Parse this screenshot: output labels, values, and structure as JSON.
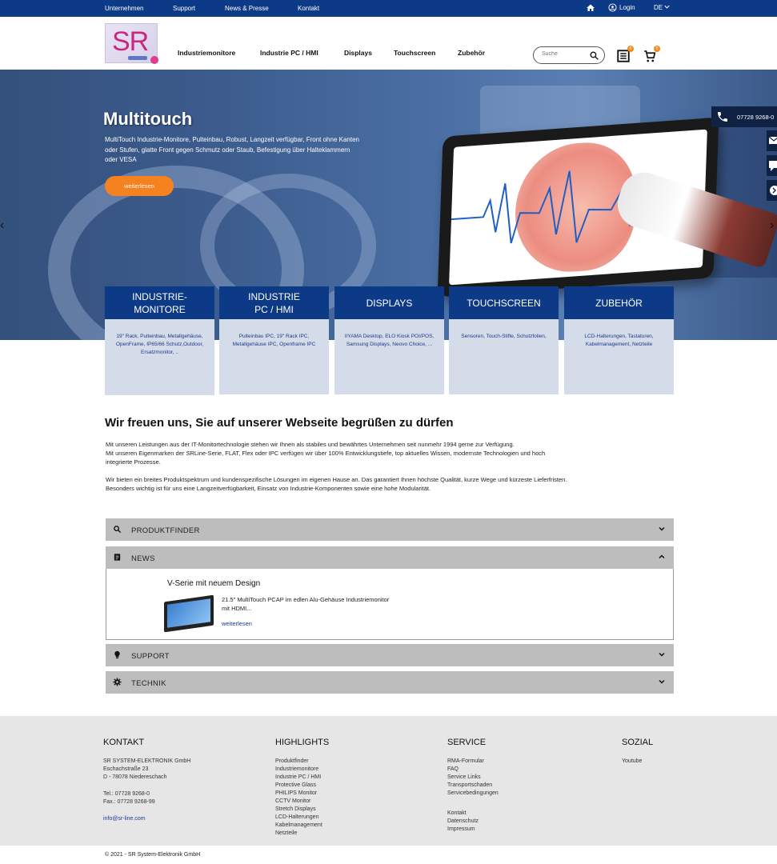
{
  "topbar": {
    "links": [
      "Unternehmen",
      "Support",
      "News & Presse",
      "Kontakt"
    ],
    "login": "Login",
    "lang": "DE"
  },
  "header": {
    "logo_text": "SR",
    "nav": [
      "Industriemonitore",
      "Industrie PC / HMI",
      "Displays",
      "Touchscreen",
      "Zubehör"
    ],
    "search_placeholder": "Suche",
    "list_badge": "0",
    "cart_badge": "0"
  },
  "hero": {
    "title": "Multitouch",
    "description": "MultiTouch Industrie-Monitore, Pulteinbau, Robust, Langzeit verfügbar, Front ohne Kanten oder Stufen, glatte Front gegen Schmutz oder Staub, Befestigung über Halteklammern oder VESA",
    "button": "weiterlesen",
    "phone": "07728 9268-0"
  },
  "categories": [
    {
      "title": "INDUSTRIE-\nMONITORE",
      "items": "19\" Rack, Pulteinbau, Metallgehäuse, OpenFrame, IP65/66 Schutz,Outdoor, Ersatzmonitor, .."
    },
    {
      "title": "INDUSTRIE\nPC / HMI",
      "items": "Pulteinbau IPC, 19\" Rack IPC, Metallgehäuse IPC, Openframe IPC"
    },
    {
      "title": "DISPLAYS",
      "items": "IIYAMA Desktop, ELO Kiosk POI/POS, Samsung Displays, Neovo Choice, ..."
    },
    {
      "title": "TOUCHSCREEN",
      "items": "Sensoren, Touch-Stifte, Schutzfolien,"
    },
    {
      "title": "ZUBEHÖR",
      "items": "LCD-Halterungen, Tastaturen, Kabelmanagement, Netzteile"
    }
  ],
  "welcome": {
    "heading": "Wir freuen uns, Sie auf unserer Webseite begrüßen zu dürfen",
    "p1_line1": "Mit unseren Leistungen aus der IT-Monitortechnologie stehen wir Ihnen als stabiles und bewährtes Unternehmen seit nunmehr 1994 gerne zur Verfügung.",
    "p1_line2": "Mit unseren Eigenmarken der SRLine-Serie, FLAT, Flex oder IPC verfügen wir über 100% Entwicklungstiefe, top aktuelles Wissen, modernste Technologien und hoch",
    "p1_line3": "integrierte Prozesse.",
    "p2_line1": "Wir bieten ein breites Produktspektrum und kundenspezifische Lösungen im eigenen Hause an. Das garantiert Ihnen höchste Qualität, kurze Wege und kürzeste Lieferfristen.",
    "p2_line2": "Besonders wichtig ist für uns eine Langzeitverfügbarkeit, Einsatz von Industrie-Komponenten sowie eine hohe Modularität."
  },
  "accordion": {
    "produktfinder": "PRODUKTFINDER",
    "news": "NEWS",
    "support": "SUPPORT",
    "technik": "TECHNIK"
  },
  "news_item": {
    "title": "V-Serie mit neuem Design",
    "text": "21.5\" MultiTouch PCAP im edlen Alu-Gehäuse Industriemonitor mit HDMI...",
    "more": "weiterlesen"
  },
  "footer": {
    "kontakt": {
      "heading": "KONTAKT",
      "company": "SR SYSTEM-ELEKTRONIK GmbH",
      "street": "Eschachstraße 23",
      "city": "D - 78078 Niedereschach",
      "tel": "Tel.: 07728 9268-0",
      "fax": "Fax.: 07728 9268-99",
      "email": "info@sr-line.com"
    },
    "highlights": {
      "heading": "HIGHLIGHTS",
      "items": [
        "Produktfinder",
        "Industriemonitore",
        "Industrie PC / HMI",
        "Protective Glass",
        "PHILIPS Monitor",
        "CCTV Monitor",
        "Stretch Displays",
        "LCD-Halterungen",
        "Kabelmanagement",
        "Netzteile"
      ]
    },
    "service": {
      "heading": "SERVICE",
      "items": [
        "RMA-Formular",
        "FAQ",
        "Service Links",
        "Transportschaden",
        "Servicebedingungen"
      ],
      "items2": [
        "Kontakt",
        "Datenschutz",
        "Impressum"
      ]
    },
    "sozial": {
      "heading": "SOZIAL",
      "items": [
        "Youtube"
      ]
    },
    "copyright": "© 2021 - SR System-Elektronik GmbH"
  }
}
